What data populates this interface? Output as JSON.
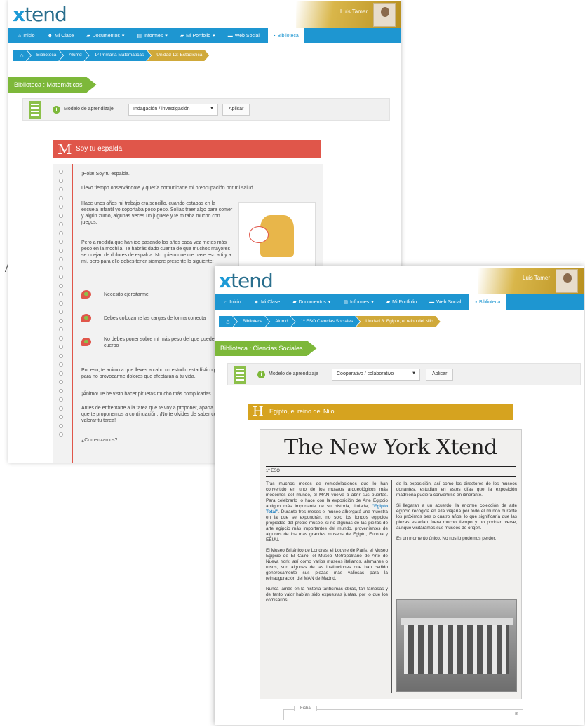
{
  "screen_a": {
    "logo": {
      "x": "x",
      "rest": "tend"
    },
    "user_name": "Luis Tamer",
    "nav": [
      "Inicio",
      "Mi Clase",
      "Documentos",
      "Informes",
      "Mi Portfolio",
      "Web Social",
      "Biblioteca"
    ],
    "breadcrumbs": [
      "Biblioteca",
      "Alumd",
      "1º Primaria Matemáticas",
      "Unidad 12: Estadística"
    ],
    "section_title": "Biblioteca : Matemáticas",
    "filter": {
      "label": "Modelo de aprendizaje",
      "selected": "Indagación / investigación",
      "apply": "Aplicar"
    },
    "story_letter": "M",
    "story_title": "Soy tu espalda",
    "lines": [
      "¡Hola! Soy tu espalda.",
      "Llevo tiempo observándote y quería comunicarte mi preocupación por mi salud...",
      "Hace unos años mi trabajo era sencillo, cuando estabas en la escuela infantil yo soportaba poco peso. Solías traer algo para comer y algún zumo, algunas veces un juguete y te miraba mucho con juegos.",
      "Pero a medida que han ido pasando los años cada vez metes más peso en la mochila. Te habrás dado cuenta de que muchos mayores se quejan de dolores de espalda. No quiero que me pase eso a ti y a mí, pero para ello debes tener siempre presente lo siguiente:",
      "Necesito ejercitarme",
      "Debes colocarme las cargas de forma correcta",
      "No debes poner sobre mí más peso del que puede soportar tu cuerpo",
      "Por eso, te animo a que lleves a cabo un estudio estadístico para llegar para no provocarme dolores que afectarán a tu vida.",
      "¡Ánimo! Te he visto hacer piruetas mucho más complicadas.",
      "Antes de enfrentarte a la tarea que te voy a proponer, aparta los apartados que te proponemos a continuación. ¡No te olvides de saber cómo se va a valorar tu tarea!",
      "¿Comenzamos?"
    ]
  },
  "screen_b": {
    "logo": {
      "x": "x",
      "rest": "tend"
    },
    "user_name": "Luis Tamer",
    "nav": [
      "Inicio",
      "Mi Clase",
      "Documentos",
      "Informes",
      "Mi Portfolio",
      "Web Social",
      "Biblioteca"
    ],
    "breadcrumbs": [
      "Biblioteca",
      "Alumd",
      "1º ESO Ciencias Sociales",
      "Unidad 8: Egipto, el reino del Nilo"
    ],
    "section_title": "Biblioteca : Ciencias Sociales",
    "filter": {
      "label": "Modelo de aprendizaje",
      "selected": "Cooperativo / colaborativo",
      "apply": "Aplicar"
    },
    "story_letter": "H",
    "story_title": "Egipto, el reino del Nilo",
    "newspaper": {
      "masthead": "The New York Xtend",
      "level": "1º ESO",
      "col1_p1_a": "Tras muchos meses de remodelaciones que lo han convertido en uno de los museos arqueológicos más modernos del mundo, el MAN vuelve a abrir sus puertas. Para celebrarlo lo hace con la exposición de Arte Egipcio antiguo más importante de su historia, titulada,",
      "col1_highlight": "\"Egipto Total\"",
      "col1_p1_b": ". Durante tres meses el museo albergará una muestra en la que se expondrán, no solo los fondos egipcios propiedad del propio museo, si no algunas de las piezas de arte egipcio más importantes del mundo, provenientes de algunos de los más grandes museos de Egipto, Europa y EEUU.",
      "col1_p2": "El Museo Británico de Londres, el Louvre de París, el Museo Egipcio de El Cairo, el Museo Metropolitano de Arte de Nueva York, así como varios museos italianos, alemanes o rusos, son algunas de las instituciones que han cedido generosamente sus piezas más valiosas para la reinauguración del MAN de Madrid.",
      "col1_p3": "Nunca jamás en la historia tantísimas obras, tan famosas y de tanto valor habían sido expuestas juntas, por lo que los comisarios",
      "col2_p1": "de la exposición, así como los directores de los museos donantes, estudian en estos días que la exposición madrileña pudiera convertirse en itinerante.",
      "col2_p2": "Si llegaran a un acuerdo, la enorme colección de arte egipcio recogida en ella viajaría por todo el mundo durante los próximos tres o cuatro años, lo que significaría que las piezas estarían fuera mucho tiempo y no podrían verse, aunque visitáramos sus museos de origen.",
      "col2_p3": "Es un momento único. No nos lo podemos perder."
    },
    "bottom_tab": "Ficha",
    "bottom_icon": "⊞"
  },
  "colors": {
    "nav_blue": "#1e96d1",
    "green": "#7db83a",
    "red": "#e0564a",
    "gold": "#d6a31f"
  }
}
